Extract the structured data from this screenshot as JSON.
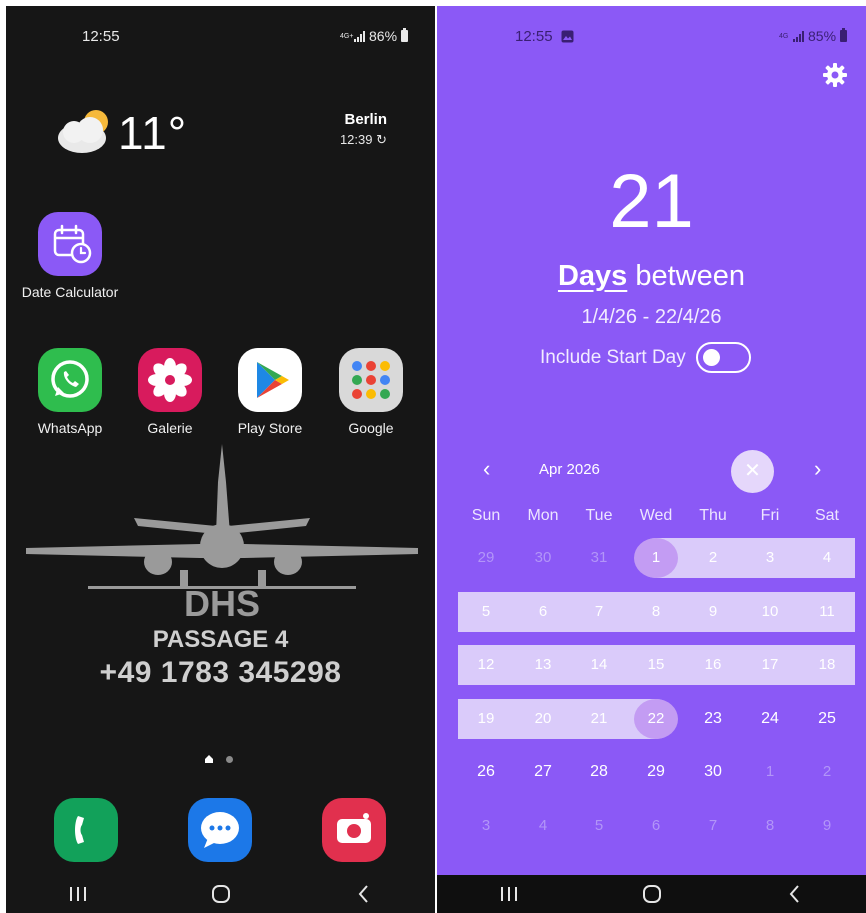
{
  "left_screen": {
    "status_bar": {
      "time": "12:55",
      "network": "4G+",
      "battery": "86%"
    },
    "weather": {
      "temperature": "11°",
      "city": "Berlin",
      "updated": "12:39 ↻"
    },
    "apps": {
      "date_calculator": "Date Calculator",
      "whatsapp": "WhatsApp",
      "galerie": "Galerie",
      "play_store": "Play Store",
      "google": "Google"
    },
    "wallpaper": {
      "brand": "DHS",
      "line1": "PASSAGE 4",
      "line2": "+49 1783 345298"
    },
    "dock_icons": [
      "phone-icon",
      "messages-icon",
      "camera-icon"
    ],
    "nav_icons": [
      "recents-icon",
      "home-icon",
      "back-icon"
    ]
  },
  "right_screen": {
    "status_bar": {
      "time": "12:55",
      "network": "4G",
      "battery": "85%"
    },
    "result": {
      "count": "21",
      "unit": "Days",
      "suffix": "between",
      "range": "1/4/26 - 22/4/26",
      "include_start_label": "Include Start Day",
      "include_start_on": false
    },
    "calendar": {
      "month_label": "Apr 2026",
      "clear_symbol": "✕",
      "prev_symbol": "‹",
      "next_symbol": "›",
      "weekdays": [
        "Sun",
        "Mon",
        "Tue",
        "Wed",
        "Thu",
        "Fri",
        "Sat"
      ],
      "weeks": [
        [
          "29",
          "30",
          "31",
          "1",
          "2",
          "3",
          "4"
        ],
        [
          "5",
          "6",
          "7",
          "8",
          "9",
          "10",
          "11"
        ],
        [
          "12",
          "13",
          "14",
          "15",
          "16",
          "17",
          "18"
        ],
        [
          "19",
          "20",
          "21",
          "22",
          "23",
          "24",
          "25"
        ],
        [
          "26",
          "27",
          "28",
          "29",
          "30",
          "1",
          "2"
        ],
        [
          "3",
          "4",
          "5",
          "6",
          "7",
          "8",
          "9"
        ]
      ],
      "selection_start": "1",
      "selection_end": "22"
    },
    "colors": {
      "accent": "#8b59f6",
      "highlight": "#dacbfa",
      "cap": "#c39cf3"
    }
  }
}
